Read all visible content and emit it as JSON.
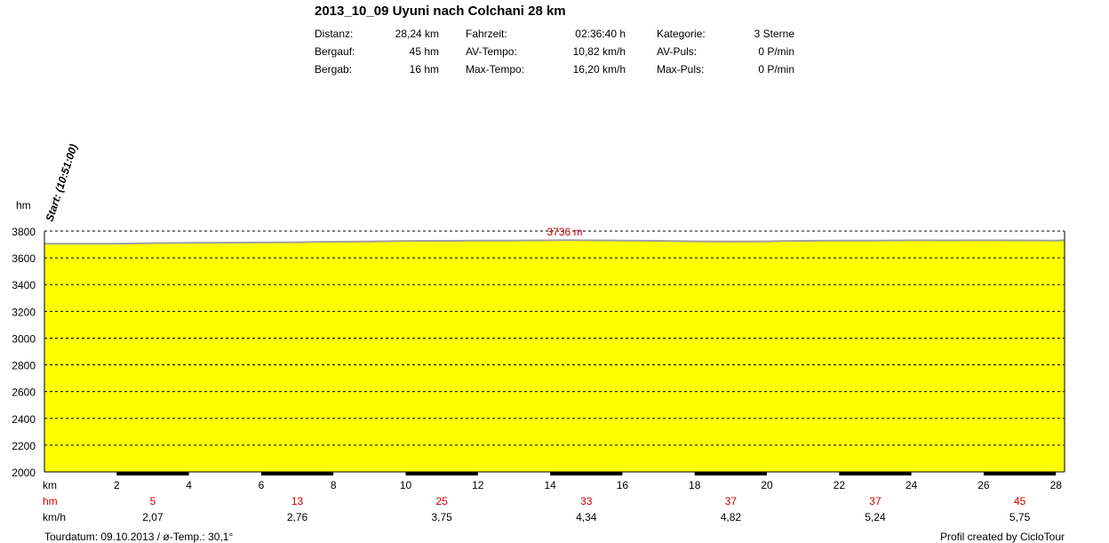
{
  "header": {
    "title": "2013_10_09 Uyuni nach Colchani 28 km",
    "stats": [
      {
        "label": "Distanz:",
        "value": "28,24 km"
      },
      {
        "label": "Bergauf:",
        "value": "45 hm"
      },
      {
        "label": "Bergab:",
        "value": "16 hm"
      },
      {
        "label": "Fahrzeit:",
        "value": "02:36:40 h"
      },
      {
        "label": "AV-Tempo:",
        "value": "10,82 km/h"
      },
      {
        "label": "Max-Tempo:",
        "value": "16,20 km/h"
      },
      {
        "label": "Kategorie:",
        "value": "3 Sterne"
      },
      {
        "label": "AV-Puls:",
        "value": "0 P/min"
      },
      {
        "label": "Max-Puls:",
        "value": "0 P/min"
      }
    ]
  },
  "footer": {
    "left": "Tourdatum: 09.10.2013  /  ø-Temp.: 30,1°",
    "right": "Profil created by CicloTour"
  },
  "colors": {
    "fill": "#ffff00",
    "profile_line": "#a0a0a0",
    "max_label": "#cc0000",
    "hm_row": "#cc0000"
  },
  "chart_data": {
    "type": "area",
    "start_label": "Start: (10:51:00)",
    "ylabel": "hm",
    "ylim": [
      2000,
      3800
    ],
    "yticks": [
      2000,
      2200,
      2400,
      2600,
      2800,
      3000,
      3200,
      3400,
      3600,
      3800
    ],
    "xlim": [
      0,
      28.24
    ],
    "max_elevation": 3736,
    "max_label": "3736 m",
    "row_labels": {
      "km": "km",
      "hm": "hm",
      "kmh": "km/h"
    },
    "km_ticks": [
      2,
      4,
      6,
      8,
      10,
      12,
      14,
      16,
      18,
      20,
      22,
      24,
      26,
      28
    ],
    "hm_row": [
      {
        "km": 3,
        "value": "5"
      },
      {
        "km": 7,
        "value": "13"
      },
      {
        "km": 11,
        "value": "25"
      },
      {
        "km": 15,
        "value": "33"
      },
      {
        "km": 19,
        "value": "37"
      },
      {
        "km": 23,
        "value": "37"
      },
      {
        "km": 27,
        "value": "45"
      }
    ],
    "speed_row": [
      {
        "km": 3,
        "value": "2,07"
      },
      {
        "km": 7,
        "value": "2,76"
      },
      {
        "km": 11,
        "value": "3,75"
      },
      {
        "km": 15,
        "value": "4,34"
      },
      {
        "km": 19,
        "value": "4,82"
      },
      {
        "km": 23,
        "value": "5,24"
      },
      {
        "km": 27,
        "value": "5,75"
      }
    ],
    "profile": {
      "x": [
        0,
        2,
        3,
        4,
        5,
        7,
        7.5,
        8,
        9,
        10,
        11,
        12,
        13,
        14,
        14.5,
        15,
        16,
        17,
        18,
        19,
        20,
        20.5,
        21,
        22,
        23,
        24,
        25,
        26,
        27,
        28,
        28.24
      ],
      "y": [
        3705,
        3706,
        3710,
        3712,
        3713,
        3716,
        3718,
        3720,
        3722,
        3726,
        3727,
        3728,
        3729,
        3731,
        3732,
        3731,
        3729,
        3727,
        3723,
        3722,
        3723,
        3726,
        3727,
        3728,
        3729,
        3731,
        3730,
        3731,
        3730,
        3729,
        3731
      ]
    }
  }
}
